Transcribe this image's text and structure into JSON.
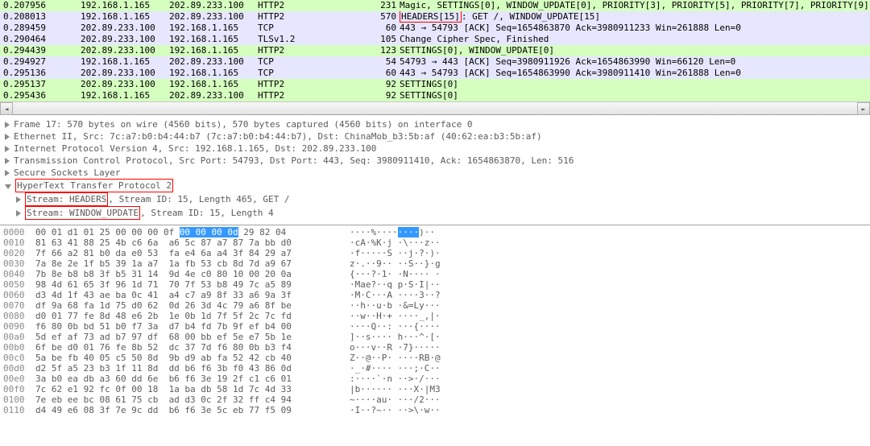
{
  "packets": [
    {
      "time": "0.207956",
      "src": "192.168.1.165",
      "dst": "202.89.233.100",
      "proto": "HTTP2",
      "len": "231",
      "class": "http2",
      "info_parts": [
        "Magic, SETTINGS[0], WINDOW_UPDATE[0], PRIORITY[3], PRIORITY[5], PRIORITY[7], PRIORITY[9], PRIORI"
      ]
    },
    {
      "time": "0.208013",
      "src": "192.168.1.165",
      "dst": "202.89.233.100",
      "proto": "HTTP2",
      "len": "570",
      "class": "http2 selected",
      "info_parts": [
        "",
        "HEADERS[15]",
        ": GET /, WINDOW_UPDATE[15]"
      ],
      "hl": 1
    },
    {
      "time": "0.289459",
      "src": "202.89.233.100",
      "dst": "192.168.1.165",
      "proto": "TCP",
      "len": "60",
      "class": "tcp",
      "info_parts": [
        "443 → 54793 [ACK] Seq=1654863870 Ack=3980911233 Win=261888 Len=0"
      ]
    },
    {
      "time": "0.290464",
      "src": "202.89.233.100",
      "dst": "192.168.1.165",
      "proto": "TLSv1.2",
      "len": "105",
      "class": "tlsv12",
      "info_parts": [
        "Change Cipher Spec, Finished"
      ]
    },
    {
      "time": "0.294439",
      "src": "202.89.233.100",
      "dst": "192.168.1.165",
      "proto": "HTTP2",
      "len": "123",
      "class": "http2",
      "info_parts": [
        "SETTINGS[0], WINDOW_UPDATE[0]"
      ]
    },
    {
      "time": "0.294927",
      "src": "192.168.1.165",
      "dst": "202.89.233.100",
      "proto": "TCP",
      "len": "54",
      "class": "tcp",
      "info_parts": [
        "54793 → 443 [ACK] Seq=3980911926 Ack=1654863990 Win=66120 Len=0"
      ]
    },
    {
      "time": "0.295136",
      "src": "202.89.233.100",
      "dst": "192.168.1.165",
      "proto": "TCP",
      "len": "60",
      "class": "tcp",
      "info_parts": [
        "443 → 54793 [ACK] Seq=1654863990 Ack=3980911410 Win=261888 Len=0"
      ]
    },
    {
      "time": "0.295137",
      "src": "202.89.233.100",
      "dst": "192.168.1.165",
      "proto": "HTTP2",
      "len": "92",
      "class": "http2",
      "info_parts": [
        "SETTINGS[0]"
      ]
    },
    {
      "time": "0.295436",
      "src": "192.168.1.165",
      "dst": "202.89.233.100",
      "proto": "HTTP2",
      "len": "92",
      "class": "http2",
      "info_parts": [
        "SETTINGS[0]"
      ]
    }
  ],
  "scroll": {
    "left": "◄",
    "right": "►"
  },
  "tree": {
    "frame": "Frame 17: 570 bytes on wire (4560 bits), 570 bytes captured (4560 bits) on interface 0",
    "eth": "Ethernet II, Src: 7c:a7:b0:b4:44:b7 (7c:a7:b0:b4:44:b7), Dst: ChinaMob_b3:5b:af (40:62:ea:b3:5b:af)",
    "ip": "Internet Protocol Version 4, Src: 192.168.1.165, Dst: 202.89.233.100",
    "tcp": "Transmission Control Protocol, Src Port: 54793, Dst Port: 443, Seq: 3980911410, Ack: 1654863870, Len: 516",
    "ssl": "Secure Sockets Layer",
    "h2": "HyperText Transfer Protocol 2",
    "s1_a": "Stream: HEADERS",
    "s1_b": ", Stream ID: 15, Length 465, GET /",
    "s2_a": "Stream: WINDOW_UPDATE",
    "s2_b": ", Stream ID: 15, Length 4"
  },
  "hex": [
    {
      "off": "0000",
      "b1": "00 01 d1 01 25 00 00 00 0f ",
      "sel": "00 00 00 0d",
      "b2": " 29 82 04   ",
      "a1": "····%····",
      "asel": "····",
      "a2": ")··"
    },
    {
      "off": "0010",
      "b1": "81 63 41 88 25 4b c6 6a  a6 5c 87 a7 87 7a bb d0   ",
      "a1": "·cA·%K·j ·\\···z··"
    },
    {
      "off": "0020",
      "b1": "7f 66 a2 81 b0 da e0 53  fa e4 6a a4 3f 84 29 a7   ",
      "a1": "·f·····S ··j·?·)·"
    },
    {
      "off": "0030",
      "b1": "7a 8e 2e 1f b5 39 1a a7  1a fb 53 cb 8d 7d a9 67   ",
      "a1": "z·.··9·· ··S··}·g"
    },
    {
      "off": "0040",
      "b1": "7b 8e b8 b8 3f b5 31 14  9d 4e c0 80 10 00 20 0a   ",
      "a1": "{···?·1· ·N···· ·"
    },
    {
      "off": "0050",
      "b1": "98 4d 61 65 3f 96 1d 71  70 7f 53 b8 49 7c a5 89   ",
      "a1": "·Mae?··q p·S·I|··"
    },
    {
      "off": "0060",
      "b1": "d3 4d 1f 43 ae ba 0c 41  a4 c7 a9 8f 33 a6 9a 3f   ",
      "a1": "·M·C···A ····3··?"
    },
    {
      "off": "0070",
      "b1": "df 9a 68 fa 1d 75 d0 62  0d 26 3d 4c 79 a6 8f be   ",
      "a1": "··h··u·b ·&=Ly···"
    },
    {
      "off": "0080",
      "b1": "d0 01 77 fe 8d 48 e6 2b  1e 0b 1d 7f 5f 2c 7c fd   ",
      "a1": "··w··H·+ ····_,|·"
    },
    {
      "off": "0090",
      "b1": "f6 80 0b bd 51 b0 f7 3a  d7 b4 fd 7b 9f ef b4 00   ",
      "a1": "····Q··: ···{····"
    },
    {
      "off": "00a0",
      "b1": "5d ef af 73 ad b7 97 df  68 00 bb ef 5e e7 5b 1e   ",
      "a1": "]··s···· h···^·[·"
    },
    {
      "off": "00b0",
      "b1": "6f be d0 01 76 fe 8b 52  dc 37 7d f6 80 0b b3 f4   ",
      "a1": "o···v··R ·7}·····"
    },
    {
      "off": "00c0",
      "b1": "5a be fb 40 05 c5 50 8d  9b d9 ab fa 52 42 cb 40   ",
      "a1": "Z··@··P· ····RB·@"
    },
    {
      "off": "00d0",
      "b1": "d2 5f a5 23 b3 1f 11 8d  dd b6 f6 3b f0 43 86 0d   ",
      "a1": "·_·#···· ···;·C··"
    },
    {
      "off": "00e0",
      "b1": "3a b0 ea db a3 60 dd 6e  b6 f6 3e 19 2f c1 c6 01   ",
      "a1": ":····`·n ··>·/···"
    },
    {
      "off": "00f0",
      "b1": "7c 62 e1 92 fc 0f 00 18  1a ba db 58 1d 7c 4d 33   ",
      "a1": "|b······ ···X·|M3"
    },
    {
      "off": "0100",
      "b1": "7e eb ee bc 08 61 75 cb  ad d3 0c 2f 32 ff c4 94   ",
      "a1": "~····au· ···/2···"
    },
    {
      "off": "0110",
      "b1": "d4 49 e6 08 3f 7e 9c dd  b6 f6 3e 5c eb 77 f5 09   ",
      "a1": "·I··?~·· ··>\\·w··"
    }
  ]
}
